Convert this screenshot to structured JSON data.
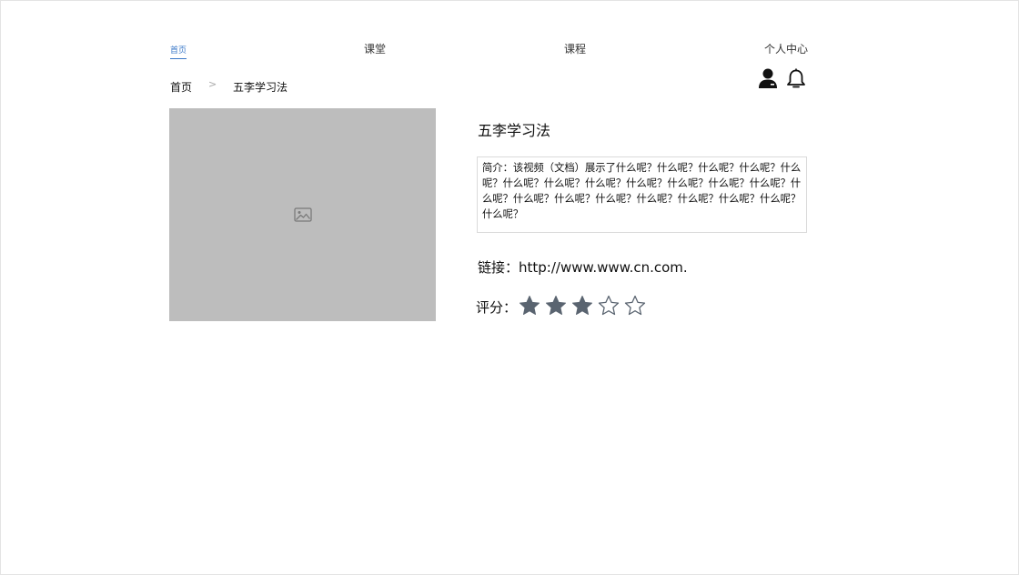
{
  "nav": {
    "home": "首页",
    "ketang": "课堂",
    "kecheng": "课程",
    "user_center": "个人中心"
  },
  "breadcrumb": {
    "home": "首页",
    "separator": ">",
    "current": "五李学习法"
  },
  "header_icons": [
    "user-icon",
    "bell-icon"
  ],
  "media": {
    "icon": "image-placeholder-icon",
    "background": "#bdbdbd"
  },
  "detail": {
    "title": "五李学习法",
    "description": "简介：该视频（文档）展示了什么呢？什么呢？什么呢？什么呢？什么呢？什么呢？什么呢？什么呢？什么呢？什么呢？什么呢？什么呢？什么呢？什么呢？什么呢？什么呢？什么呢？什么呢？什么呢？什么呢？什么呢？",
    "link_label": "链接：",
    "link_value": "http://www.www.cn.com.",
    "rating_label": "评分：",
    "rating": 3,
    "rating_max": 5
  },
  "colors": {
    "accent": "#3a78c8",
    "star_filled": "#5a6470",
    "star_empty_stroke": "#5a6470"
  }
}
